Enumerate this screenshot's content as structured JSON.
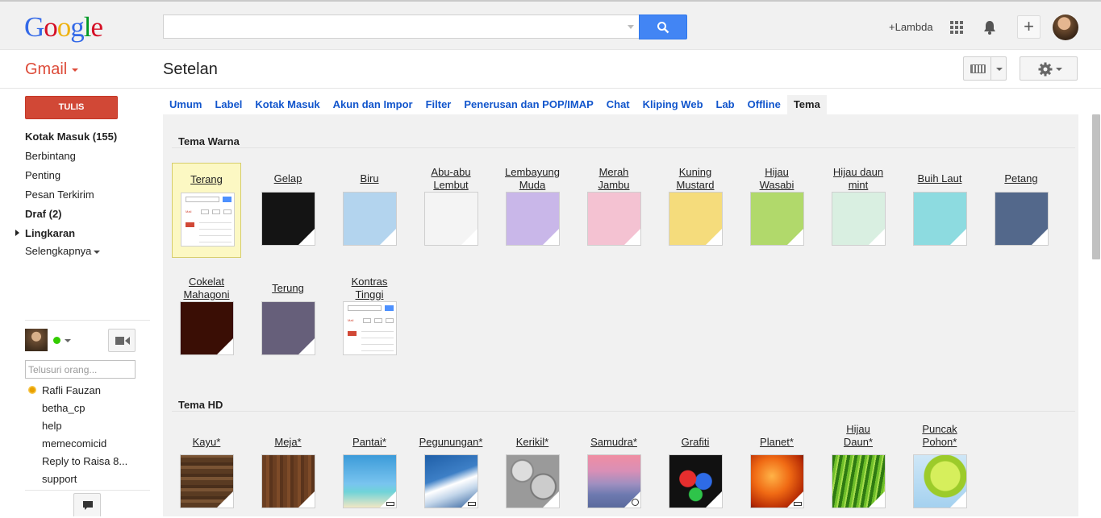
{
  "header": {
    "logo": "Google",
    "search_value": "",
    "user_link": "+Lambda",
    "icons": [
      "search-icon",
      "apps-grid-icon",
      "bell-icon",
      "plus-icon",
      "avatar"
    ]
  },
  "subbar": {
    "app_label": "Gmail",
    "page_title": "Setelan"
  },
  "sidebar": {
    "compose_label": "TULIS",
    "items": [
      {
        "label": "Kotak Masuk (155)",
        "bold": true
      },
      {
        "label": "Berbintang",
        "bold": false
      },
      {
        "label": "Penting",
        "bold": false
      },
      {
        "label": "Pesan Terkirim",
        "bold": false
      },
      {
        "label": "Draf (2)",
        "bold": true
      },
      {
        "label": "Lingkaran",
        "bold": true
      },
      {
        "label": "Selengkapnya",
        "bold": false
      }
    ],
    "people_search_placeholder": "Telusuri orang...",
    "contacts": [
      "Rafli Fauzan",
      "betha_cp",
      "help",
      "memecomicid",
      "Reply to Raisa 8...",
      "support"
    ]
  },
  "tabs": [
    "Umum",
    "Label",
    "Kotak Masuk",
    "Akun dan Impor",
    "Filter",
    "Penerusan dan POP/IMAP",
    "Chat",
    "Kliping Web",
    "Lab",
    "Offline",
    "Tema"
  ],
  "active_tab": "Tema",
  "color_themes": {
    "title": "Tema Warna",
    "items": [
      {
        "l1": "Terang",
        "l2": "",
        "color": "#ffffff",
        "selected": true
      },
      {
        "l1": "Gelap",
        "l2": "",
        "color": "#141414"
      },
      {
        "l1": "Biru",
        "l2": "",
        "color": "#b3d4ee"
      },
      {
        "l1": "Abu-abu",
        "l2": "Lembut",
        "color": "#f4f4f4"
      },
      {
        "l1": "Lembayung",
        "l2": "Muda",
        "color": "#c9b7e9"
      },
      {
        "l1": "Merah",
        "l2": "Jambu",
        "color": "#f4c2d2"
      },
      {
        "l1": "Kuning",
        "l2": "Mustard",
        "color": "#f5dc7c"
      },
      {
        "l1": "Hijau",
        "l2": "Wasabi",
        "color": "#b1d96b"
      },
      {
        "l1": "Hijau daun",
        "l2": "mint",
        "color": "#d9efe1"
      },
      {
        "l1": "Buih Laut",
        "l2": "",
        "color": "#8ddbe0"
      },
      {
        "l1": "Petang",
        "l2": "",
        "color": "#53688b"
      },
      {
        "l1": "Cokelat",
        "l2": "Mahagoni",
        "color": "#3a0e05"
      },
      {
        "l1": "Terung",
        "l2": "",
        "color": "#665f7a"
      },
      {
        "l1": "Kontras",
        "l2": "Tinggi",
        "color": "#ffffff"
      }
    ]
  },
  "hd_themes": {
    "title": "Tema HD",
    "items": [
      {
        "l1": "",
        "l2": "Kayu*",
        "bg": "repeating-linear-gradient(0deg,#5a3b22 0 6px,#7a5434 6px 10px,#4a2f1b 10px 14px)"
      },
      {
        "l1": "",
        "l2": "Meja*",
        "bg": "repeating-linear-gradient(90deg,#6b3f22 0 5px,#7e4b28 5px 9px,#5a341c 9px 13px)"
      },
      {
        "l1": "",
        "l2": "Pantai*",
        "bg": "linear-gradient(180deg,#3c9bd9 0%,#79c4ef 55%,#6fd3d8 70%,#f1e6c4 100%)"
      },
      {
        "l1": "",
        "l2": "Pegunungan*",
        "bg": "linear-gradient(160deg,#1f5fa8 0%,#3d7fc6 40%,#ffffff 55%,#c3d6ea 70%,#2f5f9c 100%)"
      },
      {
        "l1": "",
        "l2": "Kerikil*",
        "bg": "radial-gradient(circle at 30% 30%,#ddd 0 12px,#888 13px 14px,transparent 15px),radial-gradient(circle at 70% 60%,#ccc 0 14px,#777 15px 16px,transparent 17px),#9a9a9a"
      },
      {
        "l1": "",
        "l2": "Samudra*",
        "bg": "linear-gradient(180deg,#f08ea2 0%,#d98fb6 30%,#9f8fc0 55%,#6e7ab0 75%,#5a6a9c 100%)"
      },
      {
        "l1": "",
        "l2": "Grafiti",
        "bg": "radial-gradient(circle at 35% 45%,#e62e2e 0 10px,transparent 11px),radial-gradient(circle at 65% 50%,#2e6be6 0 10px,transparent 11px),radial-gradient(circle at 50% 75%,#2ec44a 0 8px,transparent 9px),#111"
      },
      {
        "l1": "",
        "l2": "Planet*",
        "bg": "radial-gradient(circle at 40% 40%,#ffb347 0%,#f06a14 40%,#b62b04 75%,#3a0a02 100%)"
      },
      {
        "l1": "Hijau",
        "l2": "Daun*",
        "bg": "repeating-linear-gradient(100deg,#2f7a12 0 4px,#6fbf2a 4px 7px,#a4dc4a 7px 9px)"
      },
      {
        "l1": "Puncak",
        "l2": "Pohon*",
        "bg": "radial-gradient(circle at 60% 40%,#d6ef5c 0 18px,#9ccb2a 19px 26px,transparent 27px),linear-gradient(180deg,#cfe7f7,#a4d1ef)"
      }
    ]
  }
}
